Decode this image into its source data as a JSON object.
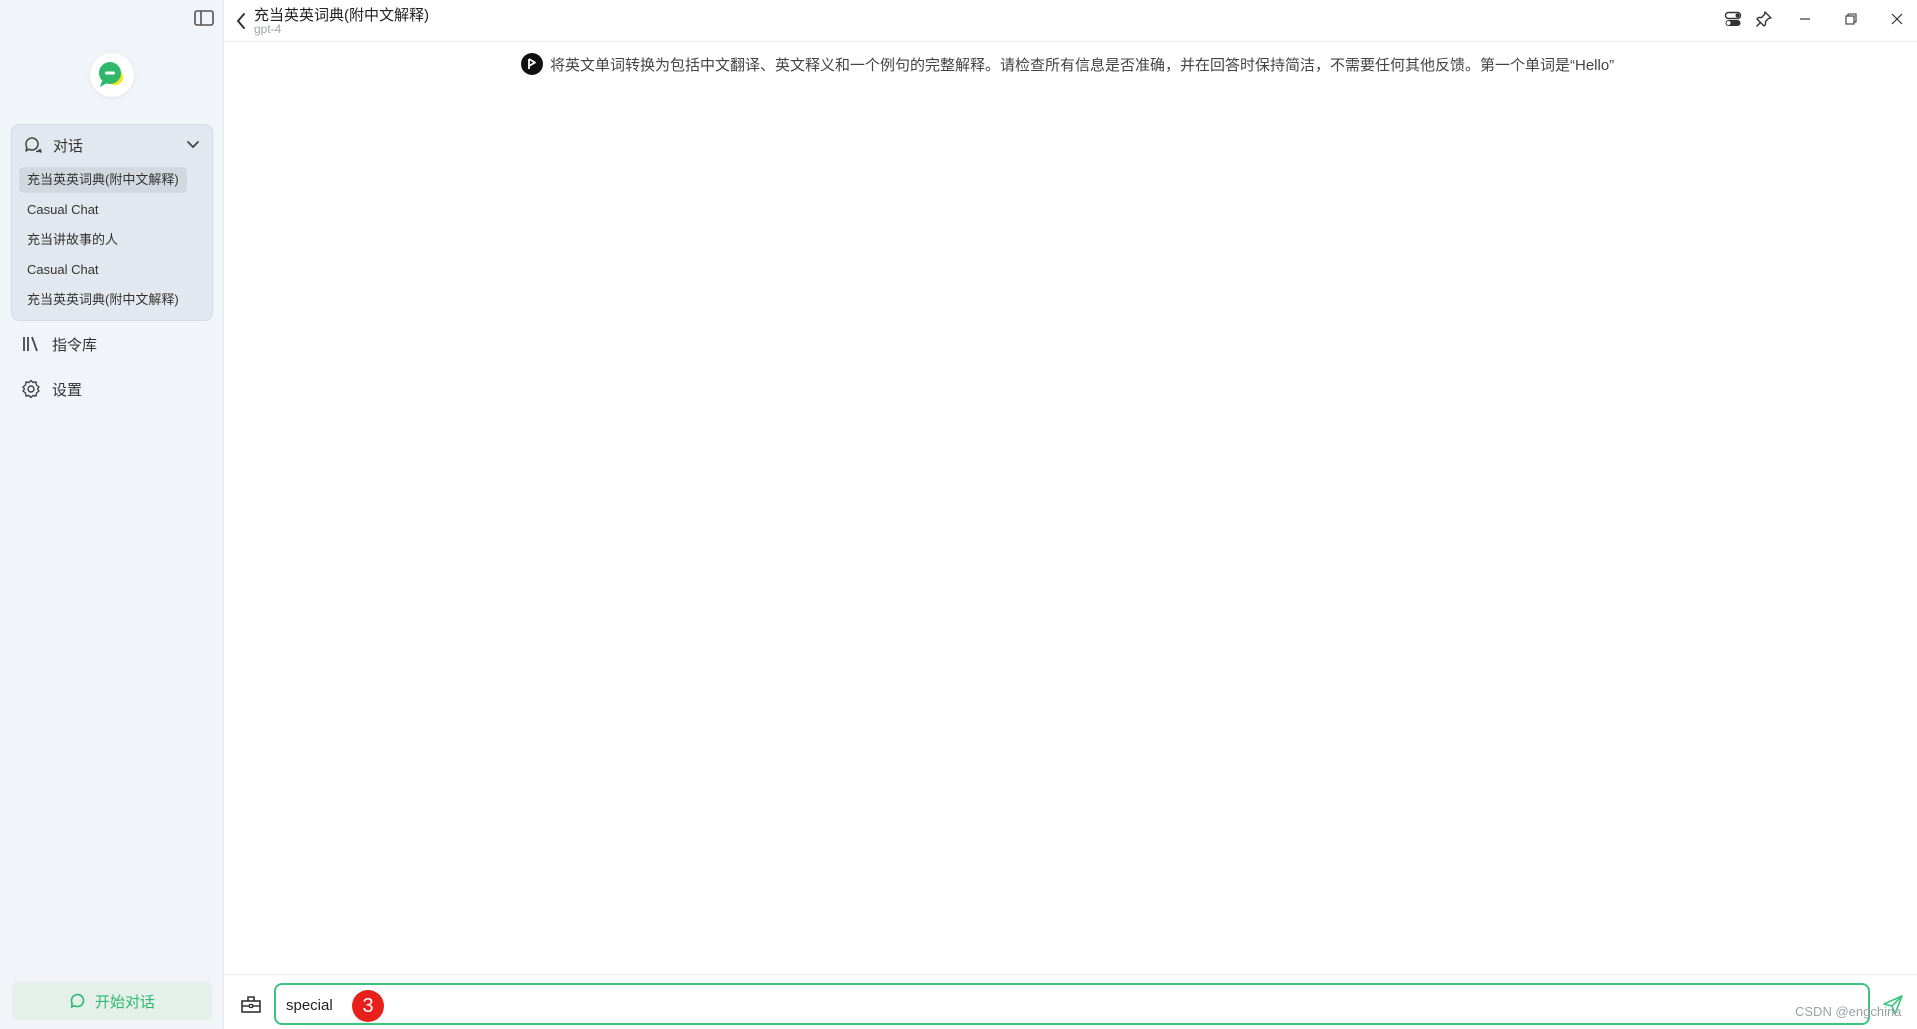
{
  "header": {
    "title": "充当英英词典(附中文解释)",
    "model": "gpt-4"
  },
  "sidebar": {
    "conversations_label": "对话",
    "conversations": [
      {
        "label": "充当英英词典(附中文解释)",
        "active": true
      },
      {
        "label": "Casual Chat",
        "active": false
      },
      {
        "label": "充当讲故事的人",
        "active": false
      },
      {
        "label": "Casual Chat",
        "active": false
      },
      {
        "label": "充当英英词典(附中文解释)",
        "active": false
      }
    ],
    "prompt_library_label": "指令库",
    "settings_label": "设置",
    "start_chat_label": "开始对话"
  },
  "system_prompt": {
    "text": "将英文单词转换为包括中文翻译、英文释义和一个例句的完整解释。请检查所有信息是否准确，并在回答时保持简洁，不需要任何其他反馈。第一个单词是“Hello”"
  },
  "input": {
    "value": "special",
    "annotation_badge": "3"
  },
  "watermark": "CSDN @engchina",
  "colors": {
    "accent_green": "#3cc47c",
    "badge_red": "#e8201b",
    "sidebar_bg": "#f1f4f9"
  },
  "icons": {
    "sidebar_toggle": "sidebar-toggle-icon",
    "logo": "chat-bubble-logo-icon",
    "conversations": "chat-bubbles-icon",
    "collapse": "chevron-down-icon",
    "library": "library-books-icon",
    "settings": "gear-icon",
    "back": "chevron-left-icon",
    "send": "send-plane-icon",
    "toolbox": "toolbox-icon"
  }
}
